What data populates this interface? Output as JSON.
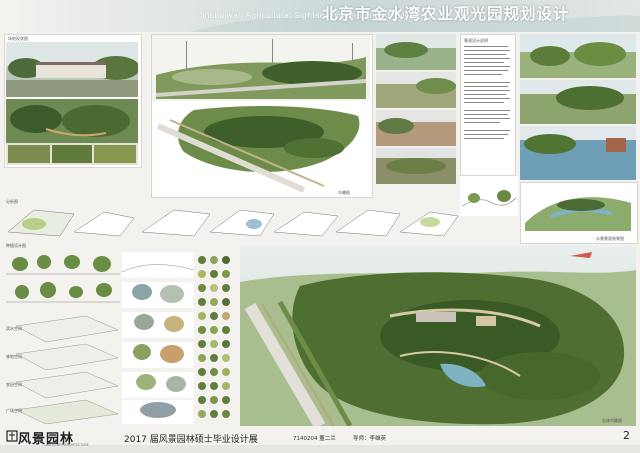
{
  "header": {
    "title_en": "Jinshuiwan Agricultural Sightseeing Garden in Beijing",
    "title_cn": "北京市金水湾农业观光园规划设计"
  },
  "labels": {
    "top_left": "场地现状图",
    "plan_caption": "鸟瞰图",
    "middle_left": "分析图",
    "lower_left": "种植设计图",
    "section_a": "滨水空间",
    "section_b": "林地空间",
    "section_c": "农田空间",
    "section_d": "广场空间",
    "text_block_title": "景观设计说明",
    "right_caption": "水景景观效果图",
    "bottom_caption": "总体鸟瞰图"
  },
  "footer": {
    "logo": "风景园林",
    "logo_sub": "LANDSCAPE ARCHITECTURE",
    "exhibition": "2017 届风景园林硕士毕业设计展",
    "student": "7140204 董二兰",
    "mentor": "导师：李雄英",
    "page_number": "2"
  }
}
